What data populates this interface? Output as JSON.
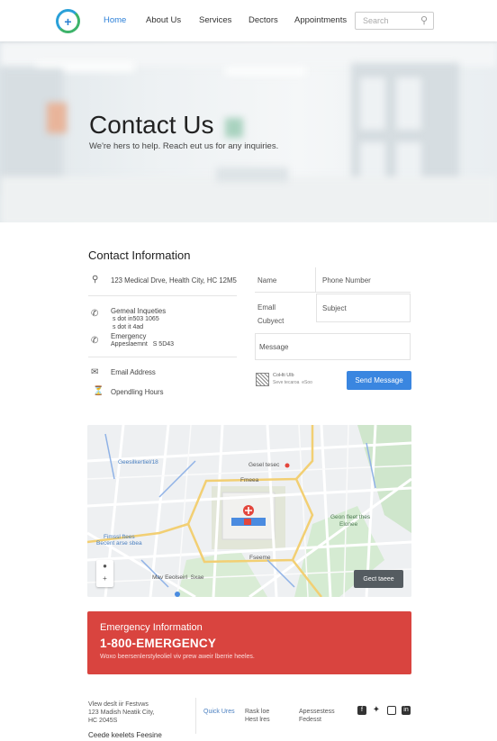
{
  "nav": {
    "links": [
      "Home",
      "About Us",
      "Services",
      "Dectors",
      "Appointments"
    ],
    "search_placeholder": "Search"
  },
  "hero": {
    "title": "Contact Us",
    "subtitle": "We're hers to help. Reach eut us for any inquiries."
  },
  "contact": {
    "title": "Contact Information",
    "address": "123 Medical Drve, Health City, HC 12M5",
    "general_label": "Gemeal Inqueties",
    "general_line1": " s dot in503 1065",
    "general_line2": " s dot it 4ad",
    "emergency_label": "Emergency",
    "emergency_line": "Appeslaemnt   S 5D43",
    "email": "Email Address",
    "hours": "Opendling Hours"
  },
  "form": {
    "name": "Name",
    "phone": "Phone Number",
    "email": "Emall",
    "subject_label": "Cubyect",
    "subject": "Subject",
    "message": "Message",
    "captcha_line1": "CoHti Ulb",
    "captcha_line2": "Seve tecaroa  eSoo",
    "submit": "Send Message"
  },
  "map": {
    "labels": [
      "Geesilkertiel/18",
      "Gesel tesec",
      "Fmeea",
      "Geon fleet thes",
      "Elonee",
      "Fimssl ftees",
      "Becent arse sbea",
      "Fseeme",
      "Mav Eeolseirl  Sxae"
    ],
    "button": "Gect taeee"
  },
  "emergency": {
    "title": "Emergency Information",
    "number": "1-800-EMERGENCY",
    "desc": "Woxo beersenlerstyleoliel viv prew aweir lberrie heeles."
  },
  "footer": {
    "addr1": "Vlew deslt iir Festvws",
    "addr2": "123 Madish Neatik City,",
    "addr3": "HC 2045S",
    "bottom": "Ceede keelets Feesine",
    "quick": "Quick Ures",
    "q1": "Rask loe",
    "q2": "Hest lres",
    "r1": "Apessestess",
    "r2": "Fedesst",
    "social": [
      "f-icon",
      "twitter-icon",
      "instagram-icon",
      "linkedin-icon"
    ]
  },
  "colors": {
    "accent": "#3a86e0",
    "emergency": "#d9443f"
  }
}
